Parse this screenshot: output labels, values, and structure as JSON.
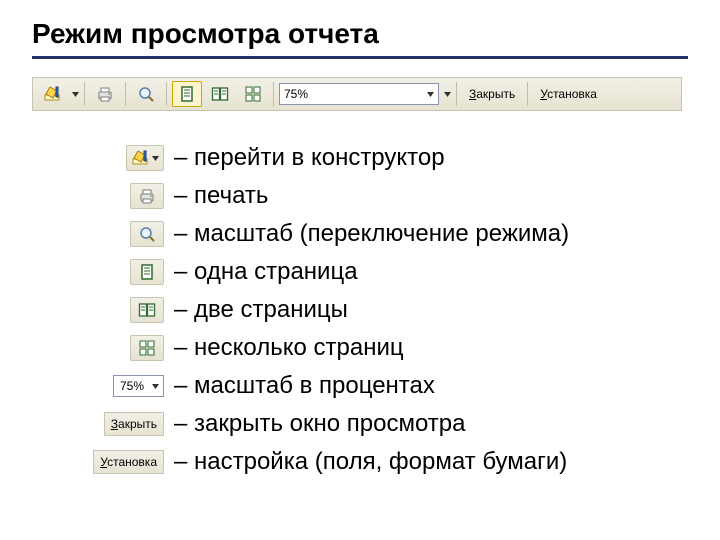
{
  "title": "Режим просмотра отчета",
  "toolbar": {
    "zoom_value": "75%",
    "close_label": "Закрыть",
    "setup_label": "Установка"
  },
  "legend": {
    "design": "– перейти в конструктор",
    "print": "– печать",
    "zoom_toggle": "– масштаб (переключение режима)",
    "one_page": "– одна страница",
    "two_pages": "– две страницы",
    "multi_pages": "– несколько страниц",
    "zoom_percent": "– масштаб в процентах",
    "close": "– закрыть окно просмотра",
    "setup": "– настройка (поля, формат бумаги)",
    "zoom_value": "75%",
    "close_label": "Закрыть",
    "setup_label": "Установка"
  }
}
